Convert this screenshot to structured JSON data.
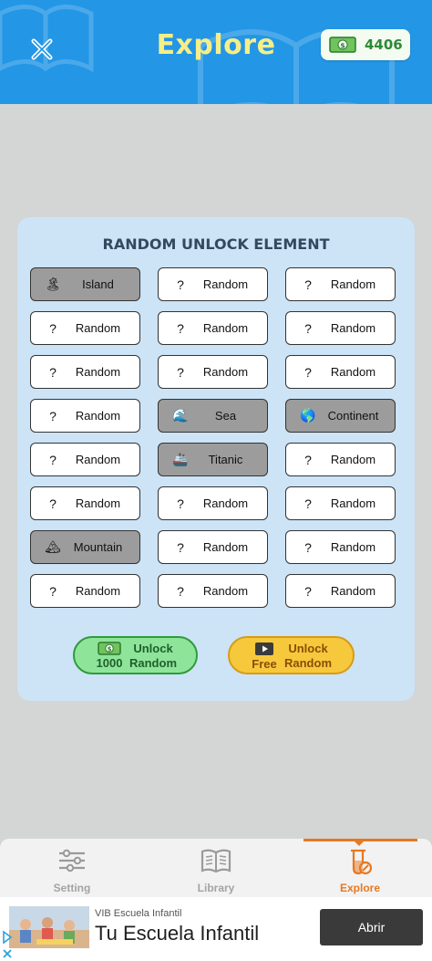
{
  "header": {
    "title": "Explore",
    "coins": "4406",
    "close_icon": "close-icon",
    "money_icon": "money-icon",
    "accent_color": "#2396e6",
    "title_color": "#f6ee86"
  },
  "panel": {
    "title": "RANDOM UNLOCK ELEMENT",
    "cells": [
      {
        "icon": "🏝",
        "label": "Island",
        "unlocked": true
      },
      {
        "icon": "?",
        "label": "Random",
        "unlocked": false
      },
      {
        "icon": "?",
        "label": "Random",
        "unlocked": false
      },
      {
        "icon": "?",
        "label": "Random",
        "unlocked": false
      },
      {
        "icon": "?",
        "label": "Random",
        "unlocked": false
      },
      {
        "icon": "?",
        "label": "Random",
        "unlocked": false
      },
      {
        "icon": "?",
        "label": "Random",
        "unlocked": false
      },
      {
        "icon": "?",
        "label": "Random",
        "unlocked": false
      },
      {
        "icon": "?",
        "label": "Random",
        "unlocked": false
      },
      {
        "icon": "?",
        "label": "Random",
        "unlocked": false
      },
      {
        "icon": "🌊",
        "label": "Sea",
        "unlocked": true
      },
      {
        "icon": "🌎",
        "label": "Continent",
        "unlocked": true
      },
      {
        "icon": "?",
        "label": "Random",
        "unlocked": false
      },
      {
        "icon": "🚢",
        "label": "Titanic",
        "unlocked": true
      },
      {
        "icon": "?",
        "label": "Random",
        "unlocked": false
      },
      {
        "icon": "?",
        "label": "Random",
        "unlocked": false
      },
      {
        "icon": "?",
        "label": "Random",
        "unlocked": false
      },
      {
        "icon": "?",
        "label": "Random",
        "unlocked": false
      },
      {
        "icon": "🏔",
        "label": "Mountain",
        "unlocked": true
      },
      {
        "icon": "?",
        "label": "Random",
        "unlocked": false
      },
      {
        "icon": "?",
        "label": "Random",
        "unlocked": false
      },
      {
        "icon": "?",
        "label": "Random",
        "unlocked": false
      },
      {
        "icon": "?",
        "label": "Random",
        "unlocked": false
      },
      {
        "icon": "?",
        "label": "Random",
        "unlocked": false
      }
    ],
    "unlock_money": {
      "price": "1000",
      "line1": "Unlock",
      "line2": "Random"
    },
    "unlock_free": {
      "price": "Free",
      "line1": "Unlock",
      "line2": "Random"
    }
  },
  "nav": {
    "items": [
      {
        "label": "Setting",
        "icon": "sliders-icon"
      },
      {
        "label": "Library",
        "icon": "book-icon"
      },
      {
        "label": "Explore",
        "icon": "test-tube-icon",
        "active": true
      }
    ]
  },
  "ad": {
    "sponsor": "VIB Escuela Infantil",
    "headline": "Tu Escuela Infantil",
    "cta": "Abrir"
  }
}
